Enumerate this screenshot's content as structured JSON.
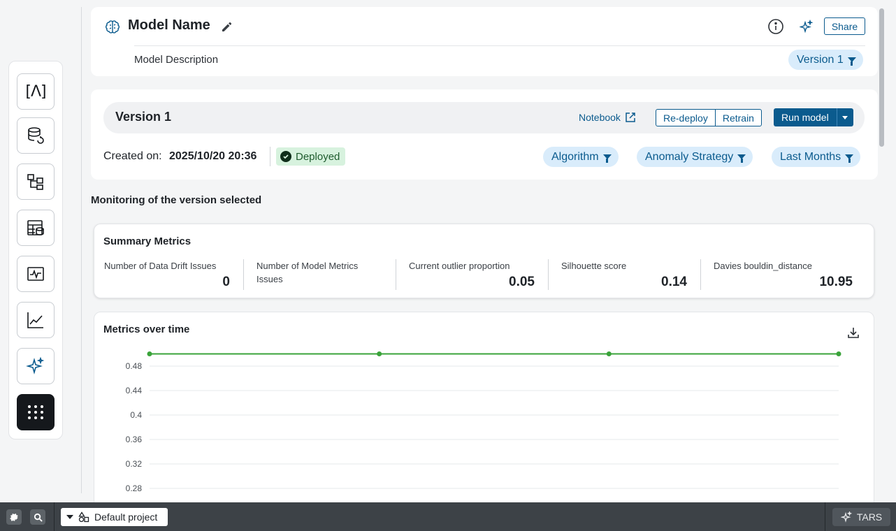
{
  "rail": {
    "items": [
      {
        "name": "lambda-icon",
        "glyph": "[Λ]"
      },
      {
        "name": "database-refresh-icon"
      },
      {
        "name": "flow-diagram-icon"
      },
      {
        "name": "table-database-icon"
      },
      {
        "name": "monitor-pulse-icon"
      },
      {
        "name": "line-chart-icon"
      },
      {
        "name": "sparkle-icon"
      },
      {
        "name": "apps-grid-icon"
      }
    ]
  },
  "header": {
    "title": "Model Name",
    "description": "Model Description",
    "share_label": "Share",
    "version_filter": "Version 1"
  },
  "version": {
    "title": "Version 1",
    "notebook_label": "Notebook",
    "redeploy_label": "Re-deploy",
    "retrain_label": "Retrain",
    "run_label": "Run model",
    "created_label": "Created on:",
    "created_value": "2025/10/20 20:36",
    "status": "Deployed",
    "filters": [
      "Algorithm",
      "Anomaly Strategy",
      "Last Months"
    ]
  },
  "monitoring_title": "Monitoring of the version selected",
  "summary": {
    "title": "Summary Metrics",
    "metrics": [
      {
        "label": "Number of Data Drift Issues",
        "value": "0"
      },
      {
        "label": "Number of Model Metrics Issues",
        "value": ""
      },
      {
        "label": "Current outlier proportion",
        "value": "0.05"
      },
      {
        "label": "Silhouette score",
        "value": "0.14"
      },
      {
        "label": "Davies bouldin_distance",
        "value": "10.95"
      }
    ]
  },
  "metrics_over_time": {
    "title": "Metrics over time"
  },
  "chart_data": {
    "type": "line",
    "title": "Metrics over time",
    "y_ticks": [
      "0.48",
      "0.44",
      "0.4",
      "0.36",
      "0.32",
      "0.28"
    ],
    "series": [
      {
        "color": "#3aa33a",
        "values": [
          0.5,
          0.5,
          0.5,
          0.5
        ]
      }
    ],
    "ylim": [
      0.28,
      0.5
    ],
    "grid": true
  },
  "bottom_bar": {
    "project_label": "Default project",
    "tars_label": "TARS"
  },
  "colors": {
    "accent": "#0b5b8e",
    "chip_bg": "#d9ecfb",
    "deployed_bg": "#d7f2de",
    "series": "#3aa33a"
  }
}
